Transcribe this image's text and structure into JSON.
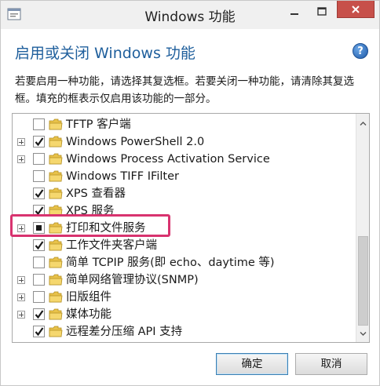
{
  "window": {
    "title": "Windows 功能",
    "heading": "启用或关闭 Windows 功能",
    "help_symbol": "?",
    "description": "若要启用一种功能，请选择其复选框。若要关闭一种功能，请清除其复选框。填充的框表示仅启用该功能的一部分。"
  },
  "features": [
    {
      "label": "TFTP 客户端",
      "expandable": false,
      "state": "unchecked"
    },
    {
      "label": "Windows PowerShell 2.0",
      "expandable": true,
      "state": "checked"
    },
    {
      "label": "Windows Process Activation Service",
      "expandable": true,
      "state": "unchecked"
    },
    {
      "label": "Windows TIFF IFilter",
      "expandable": false,
      "state": "unchecked"
    },
    {
      "label": "XPS 查看器",
      "expandable": false,
      "state": "checked"
    },
    {
      "label": "XPS 服务",
      "expandable": false,
      "state": "checked"
    },
    {
      "label": "打印和文件服务",
      "expandable": true,
      "state": "partial"
    },
    {
      "label": "工作文件夹客户端",
      "expandable": false,
      "state": "checked"
    },
    {
      "label": "简单 TCPIP 服务(即 echo、daytime 等)",
      "expandable": false,
      "state": "unchecked"
    },
    {
      "label": "简单网络管理协议(SNMP)",
      "expandable": true,
      "state": "unchecked"
    },
    {
      "label": "旧版组件",
      "expandable": true,
      "state": "unchecked"
    },
    {
      "label": "媒体功能",
      "expandable": true,
      "state": "checked"
    },
    {
      "label": "远程差分压缩 API 支持",
      "expandable": false,
      "state": "checked"
    }
  ],
  "buttons": {
    "ok": "确定",
    "cancel": "取消"
  },
  "colors": {
    "heading": "#1f5f9c",
    "highlight": "#d8336f",
    "close_button": "#c7504a",
    "folder": "#e8c24a"
  },
  "icons": {
    "app": "windows-features-icon",
    "help": "help-icon",
    "folder": "folder-icon",
    "expander": "plus-expander-icon"
  }
}
